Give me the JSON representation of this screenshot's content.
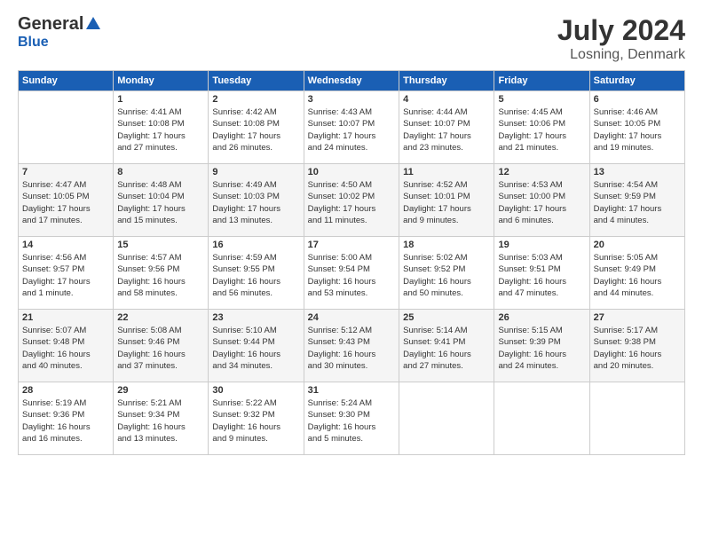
{
  "logo": {
    "general": "General",
    "blue": "Blue"
  },
  "title": "July 2024",
  "subtitle": "Losning, Denmark",
  "days_header": [
    "Sunday",
    "Monday",
    "Tuesday",
    "Wednesday",
    "Thursday",
    "Friday",
    "Saturday"
  ],
  "weeks": [
    [
      {
        "num": "",
        "info": ""
      },
      {
        "num": "1",
        "info": "Sunrise: 4:41 AM\nSunset: 10:08 PM\nDaylight: 17 hours\nand 27 minutes."
      },
      {
        "num": "2",
        "info": "Sunrise: 4:42 AM\nSunset: 10:08 PM\nDaylight: 17 hours\nand 26 minutes."
      },
      {
        "num": "3",
        "info": "Sunrise: 4:43 AM\nSunset: 10:07 PM\nDaylight: 17 hours\nand 24 minutes."
      },
      {
        "num": "4",
        "info": "Sunrise: 4:44 AM\nSunset: 10:07 PM\nDaylight: 17 hours\nand 23 minutes."
      },
      {
        "num": "5",
        "info": "Sunrise: 4:45 AM\nSunset: 10:06 PM\nDaylight: 17 hours\nand 21 minutes."
      },
      {
        "num": "6",
        "info": "Sunrise: 4:46 AM\nSunset: 10:05 PM\nDaylight: 17 hours\nand 19 minutes."
      }
    ],
    [
      {
        "num": "7",
        "info": "Sunrise: 4:47 AM\nSunset: 10:05 PM\nDaylight: 17 hours\nand 17 minutes."
      },
      {
        "num": "8",
        "info": "Sunrise: 4:48 AM\nSunset: 10:04 PM\nDaylight: 17 hours\nand 15 minutes."
      },
      {
        "num": "9",
        "info": "Sunrise: 4:49 AM\nSunset: 10:03 PM\nDaylight: 17 hours\nand 13 minutes."
      },
      {
        "num": "10",
        "info": "Sunrise: 4:50 AM\nSunset: 10:02 PM\nDaylight: 17 hours\nand 11 minutes."
      },
      {
        "num": "11",
        "info": "Sunrise: 4:52 AM\nSunset: 10:01 PM\nDaylight: 17 hours\nand 9 minutes."
      },
      {
        "num": "12",
        "info": "Sunrise: 4:53 AM\nSunset: 10:00 PM\nDaylight: 17 hours\nand 6 minutes."
      },
      {
        "num": "13",
        "info": "Sunrise: 4:54 AM\nSunset: 9:59 PM\nDaylight: 17 hours\nand 4 minutes."
      }
    ],
    [
      {
        "num": "14",
        "info": "Sunrise: 4:56 AM\nSunset: 9:57 PM\nDaylight: 17 hours\nand 1 minute."
      },
      {
        "num": "15",
        "info": "Sunrise: 4:57 AM\nSunset: 9:56 PM\nDaylight: 16 hours\nand 58 minutes."
      },
      {
        "num": "16",
        "info": "Sunrise: 4:59 AM\nSunset: 9:55 PM\nDaylight: 16 hours\nand 56 minutes."
      },
      {
        "num": "17",
        "info": "Sunrise: 5:00 AM\nSunset: 9:54 PM\nDaylight: 16 hours\nand 53 minutes."
      },
      {
        "num": "18",
        "info": "Sunrise: 5:02 AM\nSunset: 9:52 PM\nDaylight: 16 hours\nand 50 minutes."
      },
      {
        "num": "19",
        "info": "Sunrise: 5:03 AM\nSunset: 9:51 PM\nDaylight: 16 hours\nand 47 minutes."
      },
      {
        "num": "20",
        "info": "Sunrise: 5:05 AM\nSunset: 9:49 PM\nDaylight: 16 hours\nand 44 minutes."
      }
    ],
    [
      {
        "num": "21",
        "info": "Sunrise: 5:07 AM\nSunset: 9:48 PM\nDaylight: 16 hours\nand 40 minutes."
      },
      {
        "num": "22",
        "info": "Sunrise: 5:08 AM\nSunset: 9:46 PM\nDaylight: 16 hours\nand 37 minutes."
      },
      {
        "num": "23",
        "info": "Sunrise: 5:10 AM\nSunset: 9:44 PM\nDaylight: 16 hours\nand 34 minutes."
      },
      {
        "num": "24",
        "info": "Sunrise: 5:12 AM\nSunset: 9:43 PM\nDaylight: 16 hours\nand 30 minutes."
      },
      {
        "num": "25",
        "info": "Sunrise: 5:14 AM\nSunset: 9:41 PM\nDaylight: 16 hours\nand 27 minutes."
      },
      {
        "num": "26",
        "info": "Sunrise: 5:15 AM\nSunset: 9:39 PM\nDaylight: 16 hours\nand 24 minutes."
      },
      {
        "num": "27",
        "info": "Sunrise: 5:17 AM\nSunset: 9:38 PM\nDaylight: 16 hours\nand 20 minutes."
      }
    ],
    [
      {
        "num": "28",
        "info": "Sunrise: 5:19 AM\nSunset: 9:36 PM\nDaylight: 16 hours\nand 16 minutes."
      },
      {
        "num": "29",
        "info": "Sunrise: 5:21 AM\nSunset: 9:34 PM\nDaylight: 16 hours\nand 13 minutes."
      },
      {
        "num": "30",
        "info": "Sunrise: 5:22 AM\nSunset: 9:32 PM\nDaylight: 16 hours\nand 9 minutes."
      },
      {
        "num": "31",
        "info": "Sunrise: 5:24 AM\nSunset: 9:30 PM\nDaylight: 16 hours\nand 5 minutes."
      },
      {
        "num": "",
        "info": ""
      },
      {
        "num": "",
        "info": ""
      },
      {
        "num": "",
        "info": ""
      }
    ]
  ]
}
